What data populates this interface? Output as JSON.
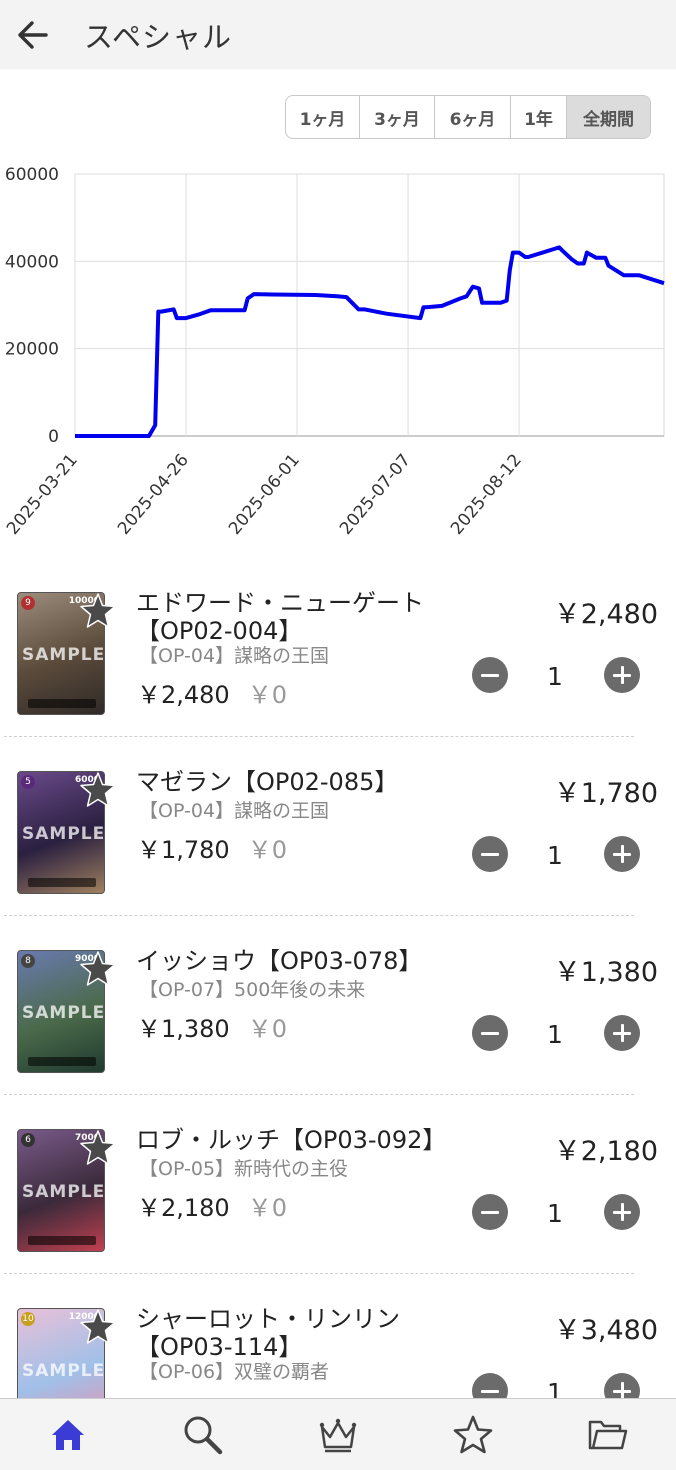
{
  "header": {
    "title": "スペシャル",
    "back_icon": "back-arrow-icon"
  },
  "range_selector": {
    "options": [
      "1ヶ月",
      "3ヶ月",
      "6ヶ月",
      "1年",
      "全期間"
    ],
    "selected": "全期間"
  },
  "chart_data": {
    "type": "line",
    "title": "",
    "xlabel": "",
    "ylabel": "",
    "ylim": [
      0,
      60000
    ],
    "yticks": [
      "0",
      "20000",
      "40000",
      "60000"
    ],
    "xticks": [
      "2025-03-21",
      "2025-04-26",
      "2025-06-01",
      "2025-07-07",
      "2025-08-12"
    ],
    "xlim": [
      "2025-03-21",
      "2025-09-28"
    ],
    "grid": true,
    "color": "#0000ee",
    "series": [
      {
        "x": [
          "2025-03-21",
          "2025-04-14",
          "2025-04-16",
          "2025-04-17",
          "2025-04-18",
          "2025-04-22",
          "2025-04-23",
          "2025-04-26",
          "2025-04-30",
          "2025-05-04",
          "2025-05-15",
          "2025-05-16",
          "2025-05-18",
          "2025-05-24",
          "2025-06-07",
          "2025-06-14",
          "2025-06-17",
          "2025-06-21",
          "2025-06-23",
          "2025-06-30",
          "2025-07-11",
          "2025-07-12",
          "2025-07-13",
          "2025-07-18",
          "2025-07-24",
          "2025-07-26",
          "2025-07-28",
          "2025-07-30",
          "2025-07-31",
          "2025-08-01",
          "2025-08-06",
          "2025-08-08",
          "2025-08-09",
          "2025-08-10",
          "2025-08-12",
          "2025-08-14",
          "2025-08-15",
          "2025-08-25",
          "2025-08-26",
          "2025-08-29",
          "2025-08-31",
          "2025-09-02",
          "2025-09-03",
          "2025-09-06",
          "2025-09-09",
          "2025-09-10",
          "2025-09-15",
          "2025-09-20",
          "2025-09-28"
        ],
        "values": [
          0,
          0,
          2500,
          28500,
          28500,
          29000,
          27000,
          27000,
          27800,
          28800,
          28800,
          31500,
          32500,
          32400,
          32300,
          32000,
          31800,
          29000,
          29000,
          28000,
          27000,
          29500,
          29500,
          29800,
          31500,
          32000,
          34200,
          33800,
          30500,
          30500,
          30500,
          31000,
          38000,
          42000,
          42000,
          41000,
          41000,
          43200,
          42500,
          40500,
          39500,
          39500,
          42000,
          40800,
          40800,
          39000,
          36800,
          36800,
          35000
        ]
      }
    ]
  },
  "items": [
    {
      "name": "エドワード・ニューゲート\n【OP02-004】",
      "set": "【OP-04】謀略の王国",
      "buy_price": "￥2,480",
      "sell_price": "￥0",
      "quantity": "1",
      "total": "￥2,480",
      "card_cost": "9",
      "card_power": "10000",
      "cost_color": "#b33030",
      "art_colors": [
        "#9c8c7c",
        "#5a4a3a",
        "#2f2a28"
      ]
    },
    {
      "name": "マゼラン【OP02-085】",
      "set": "【OP-04】謀略の王国",
      "buy_price": "￥1,780",
      "sell_price": "￥0",
      "quantity": "1",
      "total": "￥1,780",
      "card_cost": "5",
      "card_power": "6000",
      "cost_color": "#5a2a7a",
      "art_colors": [
        "#6a4a8a",
        "#2a2040",
        "#a08060"
      ]
    },
    {
      "name": "イッショウ【OP03-078】",
      "set": "【OP-07】500年後の未来",
      "buy_price": "￥1,380",
      "sell_price": "￥0",
      "quantity": "1",
      "total": "￥1,380",
      "card_cost": "8",
      "card_power": "9000",
      "cost_color": "#444444",
      "art_colors": [
        "#6a7ab0",
        "#4a6a4a",
        "#203a30"
      ]
    },
    {
      "name": "ロブ・ルッチ【OP03-092】",
      "set": "【OP-05】新時代の主役",
      "buy_price": "￥2,180",
      "sell_price": "￥0",
      "quantity": "1",
      "total": "￥2,180",
      "card_cost": "6",
      "card_power": "7000",
      "cost_color": "#333333",
      "art_colors": [
        "#7a5a8a",
        "#3a2a3a",
        "#c04050"
      ]
    },
    {
      "name": "シャーロット・リンリン\n【OP03-114】",
      "set": "【OP-06】双璧の覇者",
      "buy_price": "￥3,480",
      "sell_price": "￥0",
      "quantity": "1",
      "total": "￥3,480",
      "card_cost": "10",
      "card_power": "12000",
      "cost_color": "#c8a020",
      "art_colors": [
        "#e8c0d8",
        "#a0c0e8",
        "#e890b0"
      ]
    }
  ],
  "sample_watermark": "SAMPLE",
  "tabbar": {
    "tabs": [
      {
        "icon": "home-icon",
        "active": true
      },
      {
        "icon": "search-icon",
        "active": false
      },
      {
        "icon": "crown-icon",
        "active": false
      },
      {
        "icon": "star-icon",
        "active": false
      },
      {
        "icon": "folder-icon",
        "active": false
      }
    ],
    "active_color": "#3b3bd6"
  }
}
